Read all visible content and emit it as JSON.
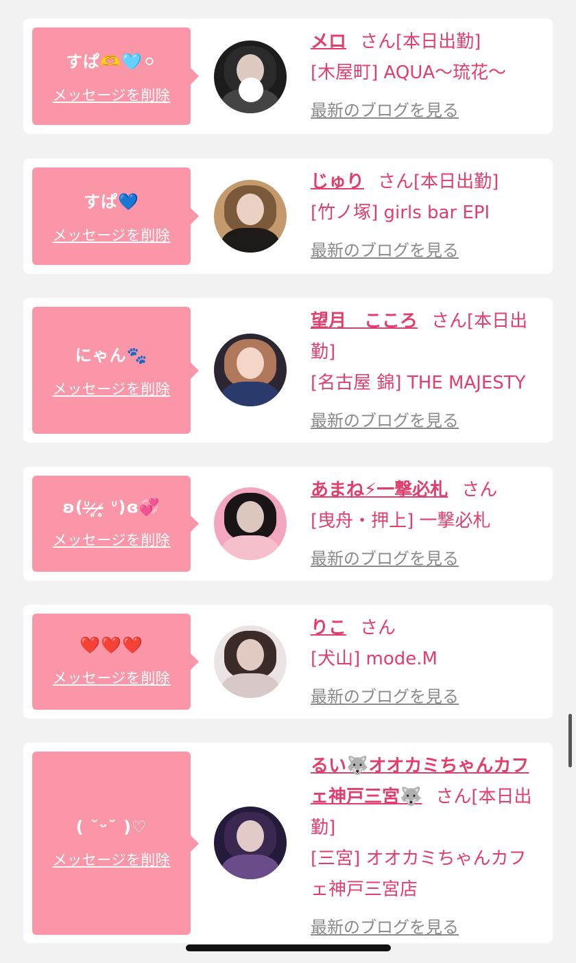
{
  "cards": [
    {
      "message": "すぱ🫶🩵⚪",
      "delete_label": "メッセージを削除",
      "name": "メロ",
      "suffix": "さん[本日出勤]",
      "shop": "[木屋町] AQUA〜琉花〜",
      "blog_label": "最新のブログを見る",
      "colors": {
        "bg": "#1c1c1c",
        "hair": "#2a2a2a",
        "body": "#444444"
      }
    },
    {
      "message": "すぱ💙",
      "delete_label": "メッセージを削除",
      "name": "じゅり",
      "suffix": "さん[本日出勤]",
      "shop": "[竹ノ塚] girls bar EPI",
      "blog_label": "最新のブログを見る",
      "colors": {
        "bg": "#c49a6c",
        "hair": "#7a5a3a",
        "body": "#1e1a18"
      }
    },
    {
      "message": "にゃん🐾",
      "delete_label": "メッセージを削除",
      "name": "望月　こころ",
      "suffix": "さん[本日出勤]",
      "shop": "[名古屋 錦] THE MAJESTY",
      "blog_label": "最新のブログを見る",
      "colors": {
        "bg": "#2c2632",
        "hair": "#b0785a",
        "body": "#2a3a6a"
      }
    },
    {
      "message": "ʚ(ᐡ ̶̷̥-̶̷̥ ᐡ)ɞ💞",
      "delete_label": "メッセージを削除",
      "name": "あまね⚡一撃必札",
      "suffix": "さん",
      "shop": "[曳舟・押上] 一撃必札",
      "blog_label": "最新のブログを見る",
      "colors": {
        "bg": "#f2a6c0",
        "hair": "#1a1416",
        "body": "#f5c0cc"
      }
    },
    {
      "message": "❤️❤️❤️",
      "delete_label": "メッセージを削除",
      "name": "りこ",
      "suffix": "さん",
      "shop": "[犬山] mode.M",
      "blog_label": "最新のブログを見る",
      "colors": {
        "bg": "#ece4e4",
        "hair": "#3a2a28",
        "body": "#d8c8c8"
      }
    },
    {
      "message": "( ˘ᵕ˘ )♡",
      "delete_label": "メッセージを削除",
      "name": "るい🐺オオカミちゃんカフェ神戸三宮🐺",
      "suffix": "さん[本日出勤]",
      "shop": "[三宮] オオカミちゃんカフェ神戸三宮店",
      "blog_label": "最新のブログを見る",
      "colors": {
        "bg": "#241a3a",
        "hair": "#3a2850",
        "body": "#6a4c8a"
      }
    }
  ]
}
